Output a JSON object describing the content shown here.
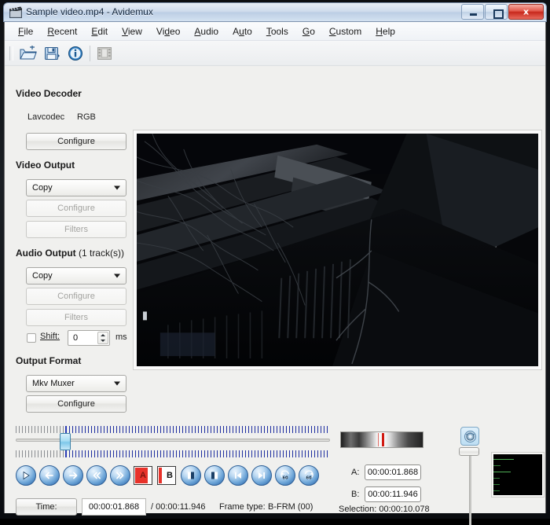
{
  "window": {
    "title": "Sample video.mp4 - Avidemux",
    "app_icon": "film-clapper-icon",
    "controls": {
      "minimize": "minimize-button",
      "maximize": "maximize-button",
      "close_label": "x"
    }
  },
  "menubar": {
    "items": [
      {
        "label": "File",
        "mnemonic": "F"
      },
      {
        "label": "Recent",
        "mnemonic": "R"
      },
      {
        "label": "Edit",
        "mnemonic": "E"
      },
      {
        "label": "View",
        "mnemonic": "V"
      },
      {
        "label": "Video",
        "mnemonic": "d"
      },
      {
        "label": "Audio",
        "mnemonic": "A"
      },
      {
        "label": "Auto",
        "mnemonic": "u"
      },
      {
        "label": "Tools",
        "mnemonic": "T"
      },
      {
        "label": "Go",
        "mnemonic": "G"
      },
      {
        "label": "Custom",
        "mnemonic": "C"
      },
      {
        "label": "Help",
        "mnemonic": "H"
      }
    ]
  },
  "toolbar": {
    "buttons": [
      {
        "name": "open-file-icon",
        "enabled": true
      },
      {
        "name": "save-file-icon",
        "enabled": true
      },
      {
        "name": "info-icon",
        "enabled": true
      },
      {
        "name": "film-strip-icon",
        "enabled": false
      }
    ]
  },
  "sidebar": {
    "video_decoder": {
      "title": "Video Decoder",
      "codec": "Lavcodec",
      "colorspace": "RGB",
      "configure_label": "Configure"
    },
    "video_output": {
      "title": "Video Output",
      "selected": "Copy",
      "configure_label": "Configure",
      "filters_label": "Filters"
    },
    "audio_output": {
      "title": "Audio Output",
      "title_suffix": " (1 track(s))",
      "selected": "Copy",
      "configure_label": "Configure",
      "filters_label": "Filters",
      "shift_label": "Shift:",
      "shift_value": "0",
      "shift_unit": "ms",
      "shift_checked": false
    },
    "output_format": {
      "title": "Output Format",
      "selected": "Mkv Muxer",
      "configure_label": "Configure"
    }
  },
  "transport": {
    "buttons": [
      {
        "name": "play-button",
        "glyph": "play"
      },
      {
        "name": "previous-frame-button",
        "glyph": "arrow-left"
      },
      {
        "name": "next-frame-button",
        "glyph": "arrow-right"
      },
      {
        "name": "previous-keyframe-button",
        "glyph": "double-left"
      },
      {
        "name": "next-keyframe-button",
        "glyph": "double-right"
      },
      {
        "name": "set-marker-a-button",
        "glyph": "A"
      },
      {
        "name": "set-marker-b-button",
        "glyph": "B"
      },
      {
        "name": "go-to-marker-a-button",
        "glyph": "half-left"
      },
      {
        "name": "go-to-marker-b-button",
        "glyph": "half-right"
      },
      {
        "name": "go-to-start-button",
        "glyph": "skip-start"
      },
      {
        "name": "go-to-end-button",
        "glyph": "skip-end"
      },
      {
        "name": "back-60s-button",
        "glyph": "60"
      },
      {
        "name": "forward-60s-button",
        "glyph": "60"
      }
    ]
  },
  "status": {
    "time_button_label": "Time:",
    "current_time": "00:00:01.868",
    "total_time": "/ 00:00:11.946",
    "frame_type_label": "Frame type:",
    "frame_type_value": "B-FRM (00)"
  },
  "markers": {
    "a_label": "A:",
    "a_value": "00:00:01.868",
    "b_label": "B:",
    "b_value": "00:00:11.946",
    "selection_label": "Selection: 00:00:10.078"
  },
  "right_controls": {
    "volume_icon": "speaker-volume-icon",
    "volume_slider": "volume-slider",
    "audio_meter": "audio-level-meter"
  },
  "colors": {
    "accent_blue": "#2c5d94",
    "marker_red": "#e8322a",
    "selection_blue": "#2a3bb5",
    "window_bg": "#f0f0ee",
    "title_bar": "#cfdcec"
  }
}
